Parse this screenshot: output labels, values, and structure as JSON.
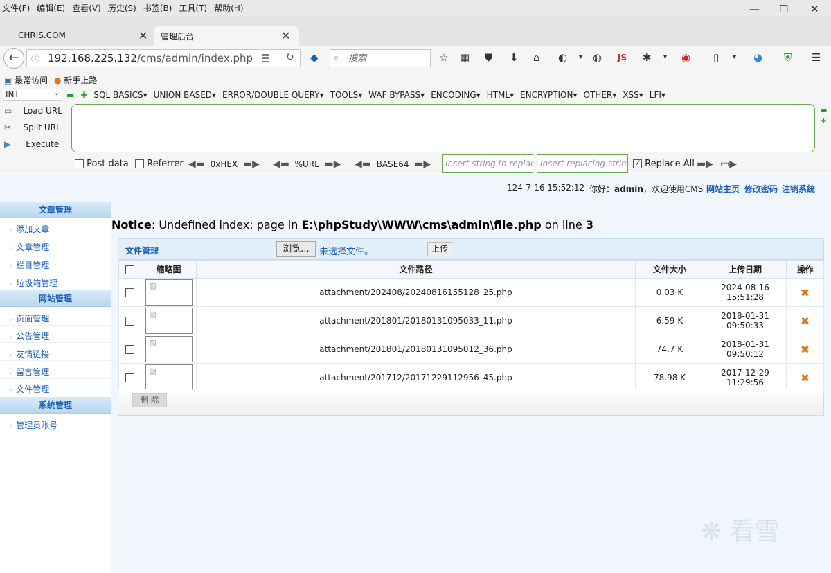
{
  "browser": {
    "menu": [
      "文件(F)",
      "编辑(E)",
      "查看(V)",
      "历史(S)",
      "书签(B)",
      "工具(T)",
      "帮助(H)"
    ],
    "window_controls": [
      "—",
      "☐",
      "✕"
    ],
    "tabs": [
      {
        "label": "CHRIS.COM",
        "close": "✕"
      },
      {
        "label": "管理后台",
        "close": "✕"
      }
    ],
    "url_host": "192.168.225.132",
    "url_path": "/cms/admin/index.php",
    "search_placeholder": "搜索",
    "bookmarks": [
      "最常访问",
      "新手上路"
    ]
  },
  "hackbar": {
    "select_value": "INT",
    "menus": [
      "SQL BASICS",
      "UNION BASED",
      "ERROR/DOUBLE QUERY",
      "TOOLS",
      "WAF BYPASS",
      "ENCODING",
      "HTML",
      "ENCRYPTION",
      "OTHER",
      "XSS",
      "LFI"
    ],
    "actions": [
      "Load URL",
      "Split URL",
      "Execute"
    ],
    "options": [
      "Post data",
      "Referrer"
    ],
    "encoders": [
      "0xHEX",
      "%URL",
      "BASE64"
    ],
    "replace_placeholder": "Insert string to replace",
    "replacing_placeholder": "Insert replacing string",
    "replace_all": "Replace All"
  },
  "top": {
    "datetime": "124-7-16 15:52:12",
    "greeting": "你好：",
    "user": "admin",
    "welcome": "，欢迎使用CMS",
    "links": [
      "网站主页",
      "修改密码",
      "注销系统"
    ]
  },
  "sidebar": {
    "sections": [
      {
        "title": "文章管理",
        "items": [
          "添加文章",
          "文章管理",
          "栏目管理",
          "垃圾箱管理"
        ]
      },
      {
        "title": "网站管理",
        "items": [
          "页面管理",
          "公告管理",
          "友情链接",
          "留言管理",
          "文件管理"
        ]
      },
      {
        "title": "系统管理",
        "items": [
          "管理员账号"
        ]
      }
    ]
  },
  "notice": {
    "label": "Notice",
    "text_a": ": Undefined index: page in ",
    "path": "E:\\phpStudy\\WWW\\cms\\admin\\file.php",
    "text_b": " on line ",
    "line": "3"
  },
  "panel": {
    "title": "文件管理",
    "browse_label": "浏览...",
    "no_file": "未选择文件。",
    "upload_label": "上传",
    "columns": [
      "缩略图",
      "文件路径",
      "文件大小",
      "上传日期",
      "操作"
    ],
    "rows": [
      {
        "path": "attachment/202408/20240816155128_25.php",
        "size": "0.03 K",
        "date": "2024-08-16",
        "time": "15:51:28"
      },
      {
        "path": "attachment/201801/20180131095033_11.php",
        "size": "6.59 K",
        "date": "2018-01-31",
        "time": "09:50:33"
      },
      {
        "path": "attachment/201801/20180131095012_36.php",
        "size": "74.7 K",
        "date": "2018-01-31",
        "time": "09:50:12"
      },
      {
        "path": "attachment/201712/20171229112956_45.php",
        "size": "78.98 K",
        "date": "2017-12-29",
        "time": "11:29:56"
      }
    ],
    "delete_icon": "✖",
    "delete_label": "删 除"
  },
  "watermark": "❋ 看雪",
  "colors": {
    "link": "#1a5fb4",
    "accent": "#e07a1a",
    "hackbar_border": "#6aa84f"
  }
}
